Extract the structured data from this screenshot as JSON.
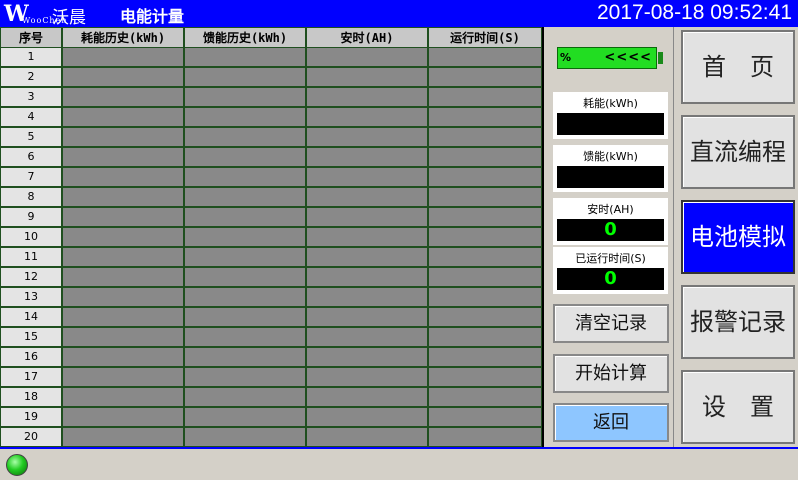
{
  "header": {
    "logo_main": "WooChen",
    "logo_cn": "沃晨",
    "title": "电能计量",
    "datetime": "2017-08-18 09:52:41"
  },
  "table": {
    "columns": [
      "序号",
      "耗能历史(kWh)",
      "馈能历史(kWh)",
      "安时(AH)",
      "运行时间(S)"
    ],
    "rows": [
      "1",
      "2",
      "3",
      "4",
      "5",
      "6",
      "7",
      "8",
      "9",
      "10",
      "11",
      "12",
      "13",
      "14",
      "15",
      "16",
      "17",
      "18",
      "19",
      "20"
    ]
  },
  "battery": {
    "percent_label": "%",
    "arrows": "<<<<"
  },
  "stats": {
    "consume_label": "耗能(kWh)",
    "consume_value": "",
    "feedback_label": "馈能(kWh)",
    "feedback_value": "",
    "ah_label": "安时(AH)",
    "ah_value": "0",
    "runtime_label": "已运行时间(S)",
    "runtime_value": "0"
  },
  "buttons": {
    "clear": "清空记录",
    "start": "开始计算",
    "back": "返回"
  },
  "nav": {
    "home": "首　页",
    "dc_program": "直流编程",
    "battery_sim": "电池模拟",
    "alarm_log": "报警记录",
    "settings": "设　置"
  },
  "colors": {
    "header_bg": "#0000ff",
    "cell_fill": "#898989",
    "grid_line": "#1f4f1f",
    "display_text": "#00ff00",
    "active_nav": "#0000ff"
  }
}
